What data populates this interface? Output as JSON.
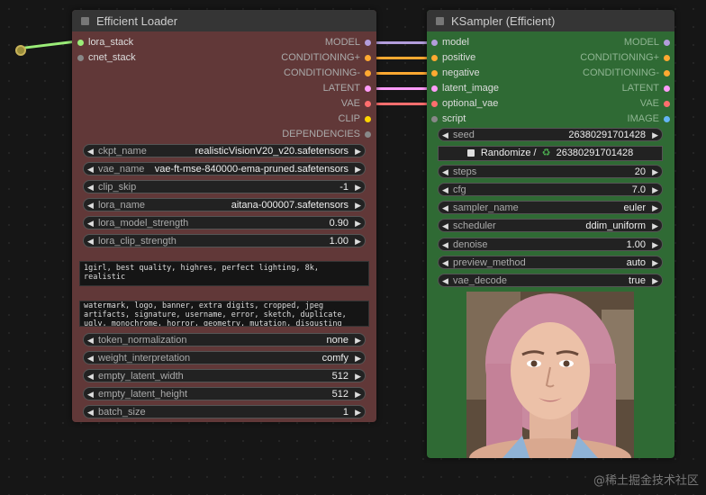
{
  "nodes": {
    "loader": {
      "title": "Efficient Loader",
      "inputs": [
        "lora_stack",
        "cnet_stack"
      ],
      "outputs": [
        "MODEL",
        "CONDITIONING+",
        "CONDITIONING-",
        "LATENT",
        "VAE",
        "CLIP",
        "DEPENDENCIES"
      ],
      "widgets": [
        {
          "label": "ckpt_name",
          "value": "realisticVisionV20_v20.safetensors"
        },
        {
          "label": "vae_name",
          "value": "vae-ft-mse-840000-ema-pruned.safetensors"
        },
        {
          "label": "clip_skip",
          "value": "-1"
        },
        {
          "label": "lora_name",
          "value": "aitana-000007.safetensors"
        },
        {
          "label": "lora_model_strength",
          "value": "0.90"
        },
        {
          "label": "lora_clip_strength",
          "value": "1.00"
        }
      ],
      "positive_prompt": "1girl, best quality, highres, perfect lighting, 8k, realistic",
      "negative_prompt": "watermark, logo, banner, extra digits, cropped, jpeg artifacts, signature, username, error, sketch, duplicate, ugly, monochrome, horror, geometry, mutation, disgusting",
      "widgets2": [
        {
          "label": "token_normalization",
          "value": "none"
        },
        {
          "label": "weight_interpretation",
          "value": "comfy"
        },
        {
          "label": "empty_latent_width",
          "value": "512"
        },
        {
          "label": "empty_latent_height",
          "value": "512"
        },
        {
          "label": "batch_size",
          "value": "1"
        }
      ]
    },
    "sampler": {
      "title": "KSampler (Efficient)",
      "inputs": [
        "model",
        "positive",
        "negative",
        "latent_image",
        "optional_vae",
        "script"
      ],
      "outputs": [
        "MODEL",
        "CONDITIONING+",
        "CONDITIONING-",
        "LATENT",
        "VAE",
        "IMAGE"
      ],
      "seed": {
        "label": "seed",
        "value": "26380291701428"
      },
      "randomize_label": "Randomize /",
      "randomize_value": "26380291701428",
      "widgets": [
        {
          "label": "steps",
          "value": "20"
        },
        {
          "label": "cfg",
          "value": "7.0"
        },
        {
          "label": "sampler_name",
          "value": "euler"
        },
        {
          "label": "scheduler",
          "value": "ddim_uniform"
        },
        {
          "label": "denoise",
          "value": "1.00"
        },
        {
          "label": "preview_method",
          "value": "auto"
        },
        {
          "label": "vae_decode",
          "value": "true"
        }
      ]
    }
  },
  "watermark": "@稀土掘金技术社区",
  "colors": {
    "loader_body": "#613838",
    "sampler_body": "#2f6a34",
    "model_wire": "#b39ddb",
    "conditioning_wire": "#ffa931",
    "latent_wire": "#ff9cf9",
    "vae_wire": "#ff6e6e",
    "lora_wire": "#9bed78"
  }
}
